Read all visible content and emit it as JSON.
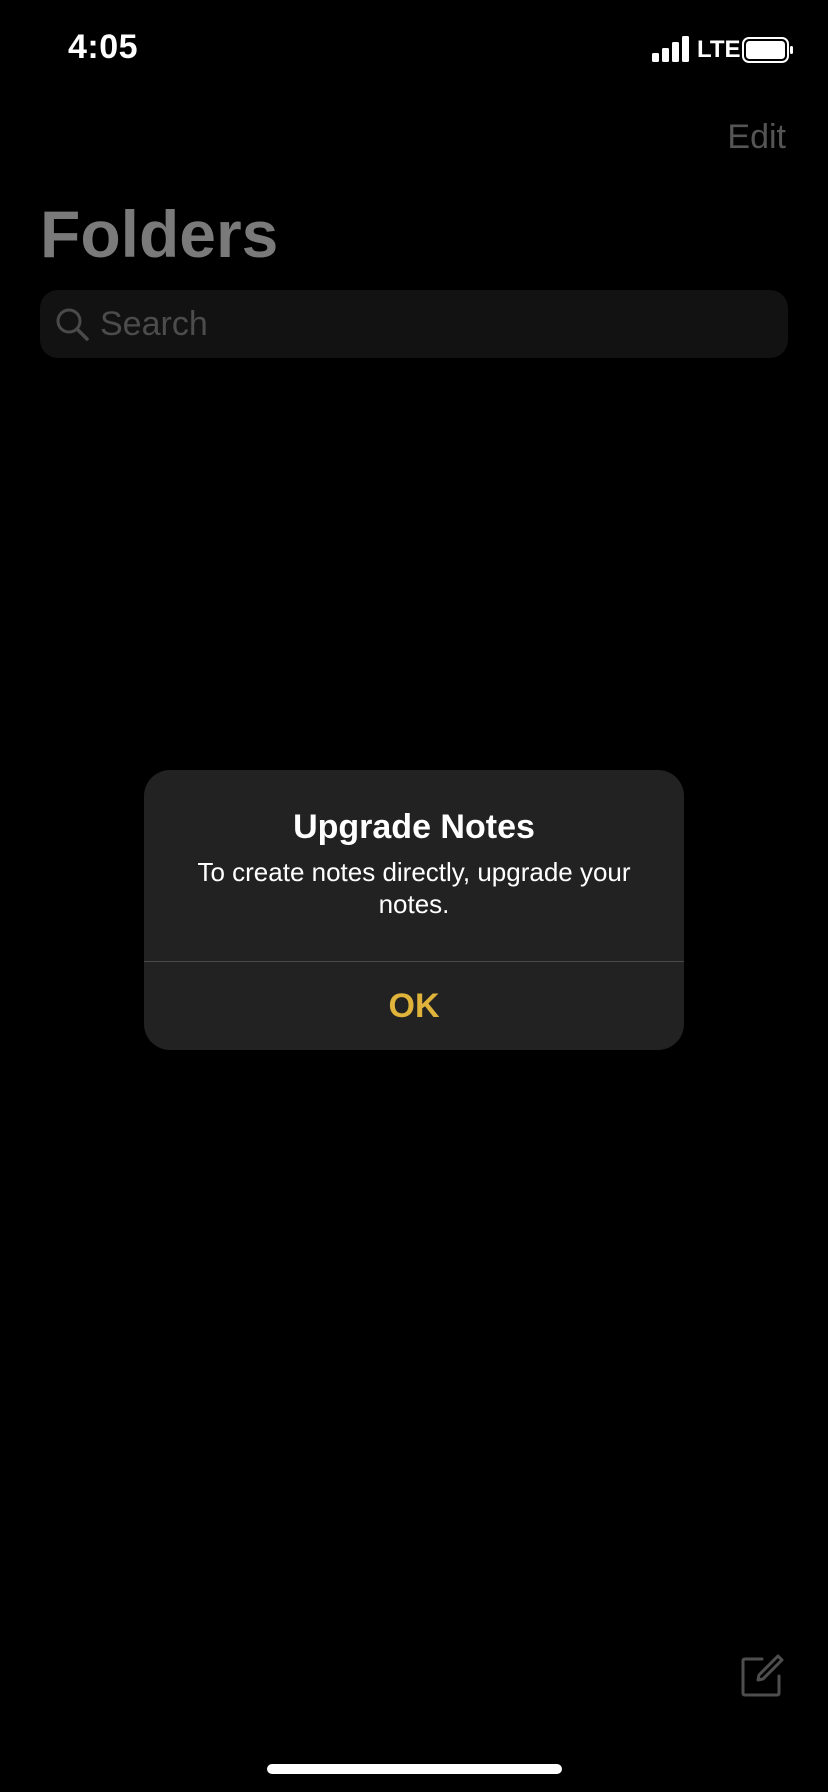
{
  "status_bar": {
    "time": "4:05",
    "network": "LTE",
    "signal_icon": "cellular-signal-icon",
    "battery_icon": "battery-icon"
  },
  "header": {
    "edit_label": "Edit",
    "title": "Folders"
  },
  "search": {
    "placeholder": "Search",
    "icon": "search-icon"
  },
  "toolbar": {
    "compose_icon": "compose-icon"
  },
  "alert": {
    "title": "Upgrade Notes",
    "message": "To create notes directly, upgrade your notes.",
    "ok_label": "OK"
  },
  "colors": {
    "background": "#000000",
    "alert_background": "#222222",
    "accent": "#e0b33a",
    "dimmed_text": "#7a7a7a"
  }
}
